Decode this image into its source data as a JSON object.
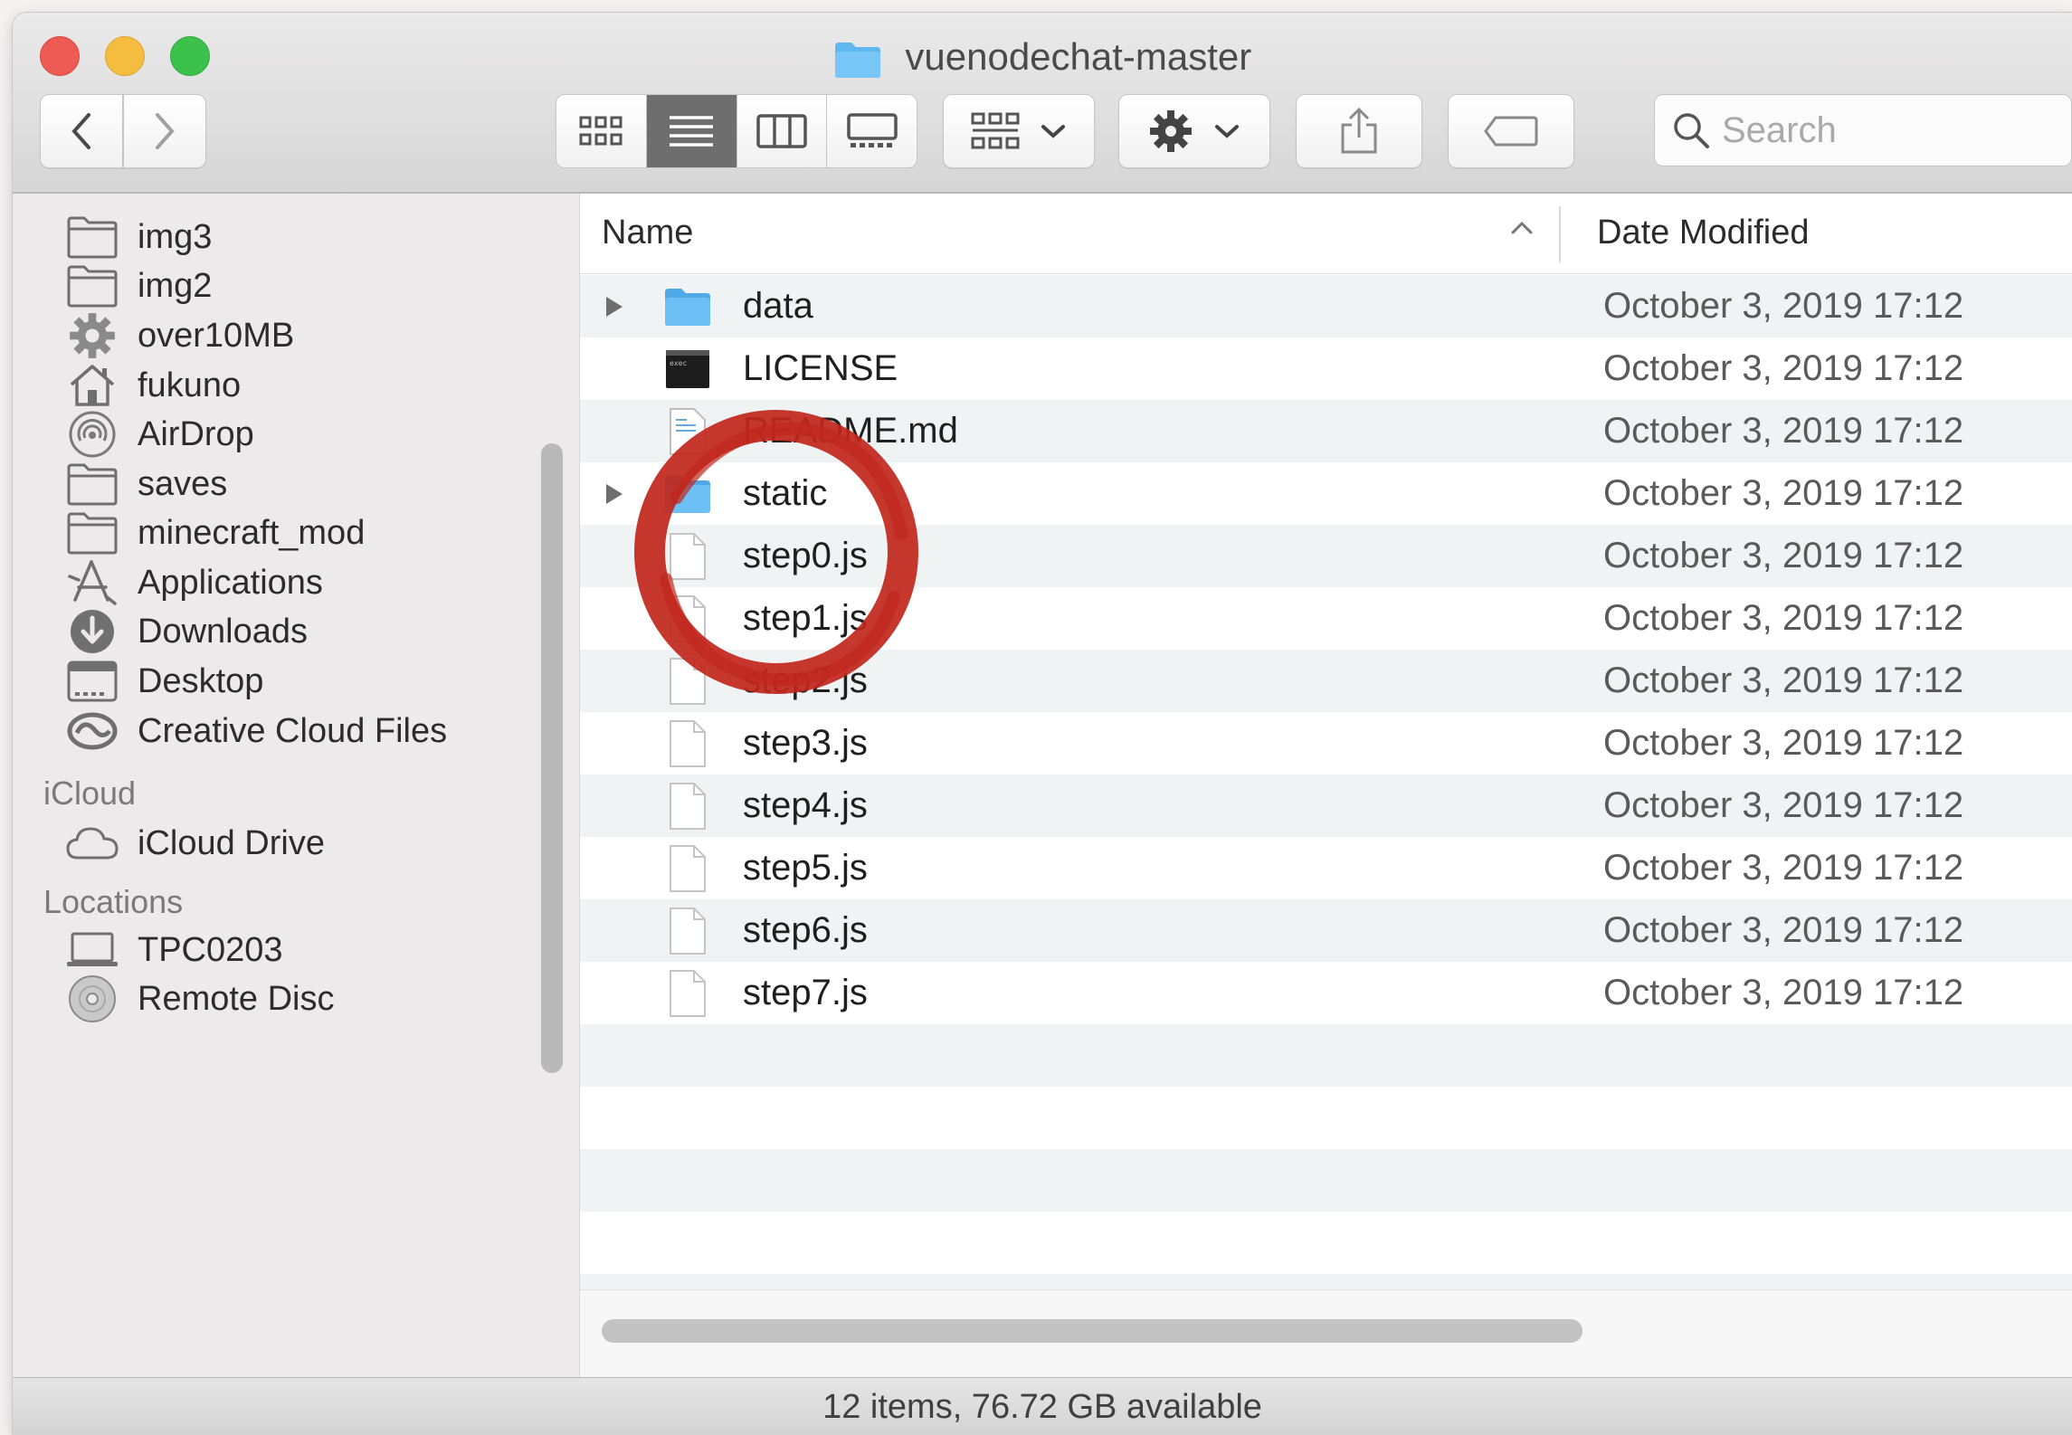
{
  "window": {
    "title": "vuenodechat-master"
  },
  "toolbar": {
    "search_placeholder": "Search",
    "view_modes": [
      "icon-view-icon",
      "list-view-icon",
      "column-view-icon",
      "gallery-view-icon"
    ],
    "active_view": "list"
  },
  "sidebar": {
    "items": [
      {
        "label": "img3",
        "icon": "folder-icon"
      },
      {
        "label": "img2",
        "icon": "folder-icon"
      },
      {
        "label": "over10MB",
        "icon": "gear-icon"
      },
      {
        "label": "fukuno",
        "icon": "home-icon"
      },
      {
        "label": "AirDrop",
        "icon": "airdrop-icon"
      },
      {
        "label": "saves",
        "icon": "folder-icon"
      },
      {
        "label": "minecraft_mod",
        "icon": "folder-icon"
      },
      {
        "label": "Applications",
        "icon": "applications-icon"
      },
      {
        "label": "Downloads",
        "icon": "downloads-icon"
      },
      {
        "label": "Desktop",
        "icon": "desktop-icon"
      },
      {
        "label": "Creative Cloud Files",
        "icon": "creative-cloud-icon"
      }
    ],
    "icloud_header": "iCloud",
    "icloud_items": [
      {
        "label": "iCloud Drive",
        "icon": "cloud-icon"
      }
    ],
    "locations_header": "Locations",
    "location_items": [
      {
        "label": "TPC0203",
        "icon": "laptop-icon"
      },
      {
        "label": "Remote Disc",
        "icon": "disc-icon"
      }
    ]
  },
  "list": {
    "columns": {
      "name": "Name",
      "date": "Date Modified"
    },
    "rows": [
      {
        "name": "data",
        "date": "October 3, 2019 17:12",
        "kind": "folder"
      },
      {
        "name": "LICENSE",
        "date": "October 3, 2019 17:12",
        "kind": "exec"
      },
      {
        "name": "README.md",
        "date": "October 3, 2019 17:12",
        "kind": "doc"
      },
      {
        "name": "static",
        "date": "October 3, 2019 17:12",
        "kind": "folder"
      },
      {
        "name": "step0.js",
        "date": "October 3, 2019 17:12",
        "kind": "file"
      },
      {
        "name": "step1.js",
        "date": "October 3, 2019 17:12",
        "kind": "file"
      },
      {
        "name": "step2.js",
        "date": "October 3, 2019 17:12",
        "kind": "file"
      },
      {
        "name": "step3.js",
        "date": "October 3, 2019 17:12",
        "kind": "file"
      },
      {
        "name": "step4.js",
        "date": "October 3, 2019 17:12",
        "kind": "file"
      },
      {
        "name": "step5.js",
        "date": "October 3, 2019 17:12",
        "kind": "file"
      },
      {
        "name": "step6.js",
        "date": "October 3, 2019 17:12",
        "kind": "file"
      },
      {
        "name": "step7.js",
        "date": "October 3, 2019 17:12",
        "kind": "file"
      }
    ]
  },
  "status": {
    "text": "12 items, 76.72 GB available"
  },
  "colors": {
    "annotation_red": "#c1271c",
    "folder_blue": "#5fb7ef",
    "close": "#ee5b54",
    "minimize": "#f4bd3f",
    "zoom": "#3cc24c"
  }
}
